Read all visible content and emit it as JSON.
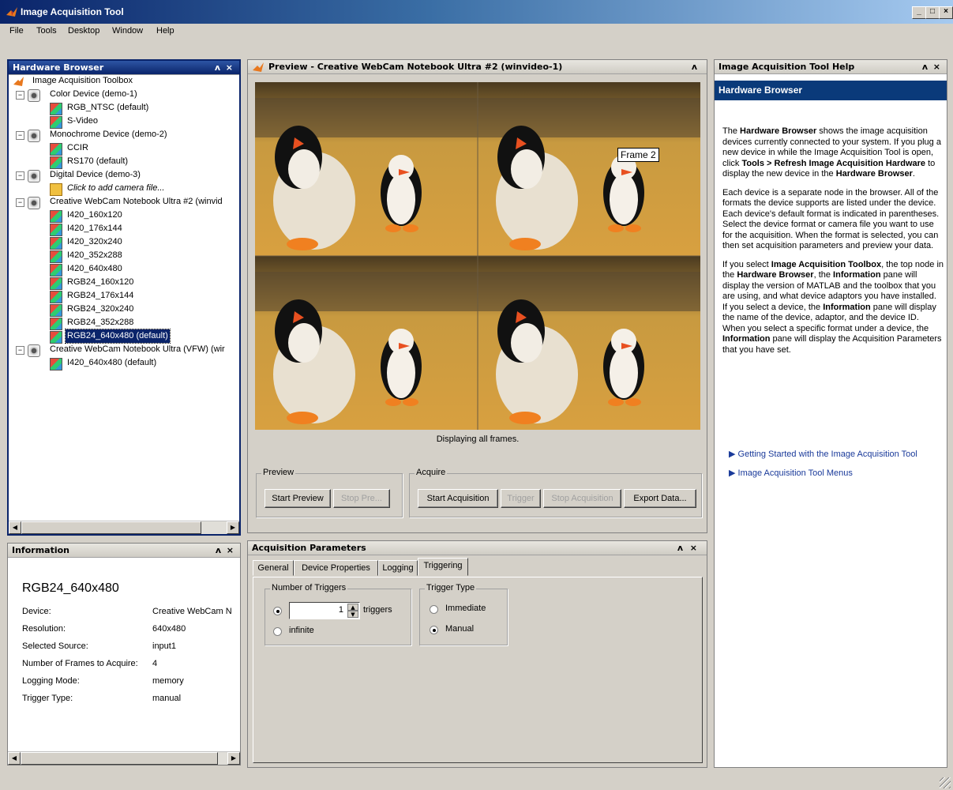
{
  "window": {
    "title": "Image Acquisition Tool",
    "min": "_",
    "max": "□",
    "close": "×"
  },
  "menu": [
    "File",
    "Tools",
    "Desktop",
    "Window",
    "Help"
  ],
  "hardware_browser": {
    "title": "Hardware Browser",
    "pin": "ʌ",
    "close": "×",
    "root": "Image Acquisition Toolbox",
    "items": [
      "Color Device (demo-1)",
      "RGB_NTSC (default)",
      "S-Video",
      "Monochrome Device (demo-2)",
      "CCIR",
      "RS170 (default)",
      "Digital Device (demo-3)",
      "Click to add camera file...",
      "Creative WebCam Notebook Ultra #2 (winvid",
      "I420_160x120",
      "I420_176x144",
      "I420_320x240",
      "I420_352x288",
      "I420_640x480",
      "RGB24_160x120",
      "RGB24_176x144",
      "RGB24_320x240",
      "RGB24_352x288",
      "RGB24_640x480 (default)",
      "Creative WebCam Notebook Ultra (VFW) (wir",
      "I420_640x480 (default)"
    ]
  },
  "information": {
    "title": "Information",
    "heading": "RGB24_640x480",
    "rows": [
      {
        "label": "Device:",
        "value": "Creative WebCam N"
      },
      {
        "label": "Resolution:",
        "value": "640x480"
      },
      {
        "label": "Selected Source:",
        "value": "input1"
      },
      {
        "label": "Number of Frames to Acquire:",
        "value": "4"
      },
      {
        "label": "Logging Mode:",
        "value": "memory"
      },
      {
        "label": "Trigger Type:",
        "value": "manual"
      }
    ]
  },
  "preview": {
    "title": "Preview - Creative WebCam Notebook Ultra #2 (winvideo-1)",
    "frame_label": "Frame 2",
    "status": "Displaying all frames.",
    "preview_group": "Preview",
    "start_preview": "Start Preview",
    "stop_preview": "Stop Pre...",
    "acquire_group": "Acquire",
    "start_acquisition": "Start Acquisition",
    "trigger": "Trigger",
    "stop_acquisition": "Stop Acquisition",
    "export_data": "Export Data..."
  },
  "acq_params": {
    "title": "Acquisition Parameters",
    "tabs": [
      "General",
      "Device Properties",
      "Logging",
      "Triggering"
    ],
    "active_tab": "Triggering",
    "num_triggers_group": "Number of Triggers",
    "num_triggers_value": "1",
    "triggers_unit": "triggers",
    "infinite": "infinite",
    "trigger_type_group": "Trigger Type",
    "immediate": "Immediate",
    "manual": "Manual"
  },
  "help": {
    "title": "Image Acquisition Tool Help",
    "heading": "Hardware Browser",
    "p1_a": "The ",
    "p1_b": "Hardware Browser",
    "p1_c": " shows the image acquisition devices currently connected to your system. If you plug a new device in while the Image Acquisition Tool is open, click ",
    "p1_d": "Tools > Refresh Image Acquisition Hardware",
    "p1_e": " to display the new device in the ",
    "p1_f": "Hardware Browser",
    "p1_g": ".",
    "p2": "Each device is a separate node in the browser. All of the formats the device supports are listed under the device. Each device's default format is indicated in parentheses. Select the device format or camera file you want to use for the acquisition. When the format is selected, you can then set acquisition parameters and preview your data.",
    "p3_a": "If you select ",
    "p3_b": "Image Acquisition Toolbox",
    "p3_c": ", the top node in the ",
    "p3_d": "Hardware Browser",
    "p3_e": ", the ",
    "p3_f": "Information",
    "p3_g": " pane will display the version of MATLAB and the toolbox that you are using, and what device adaptors you have installed. If you select a device, the ",
    "p3_h": "Information",
    "p3_i": " pane will display the name of the device, adaptor, and the device ID. When you select a specific format under a device, the ",
    "p3_j": "Information",
    "p3_k": " pane will display the Acquisition Parameters that you have set.",
    "link1": "Getting Started with the Image Acquisition Tool",
    "link2": "Image Acquisition Tool Menus"
  }
}
